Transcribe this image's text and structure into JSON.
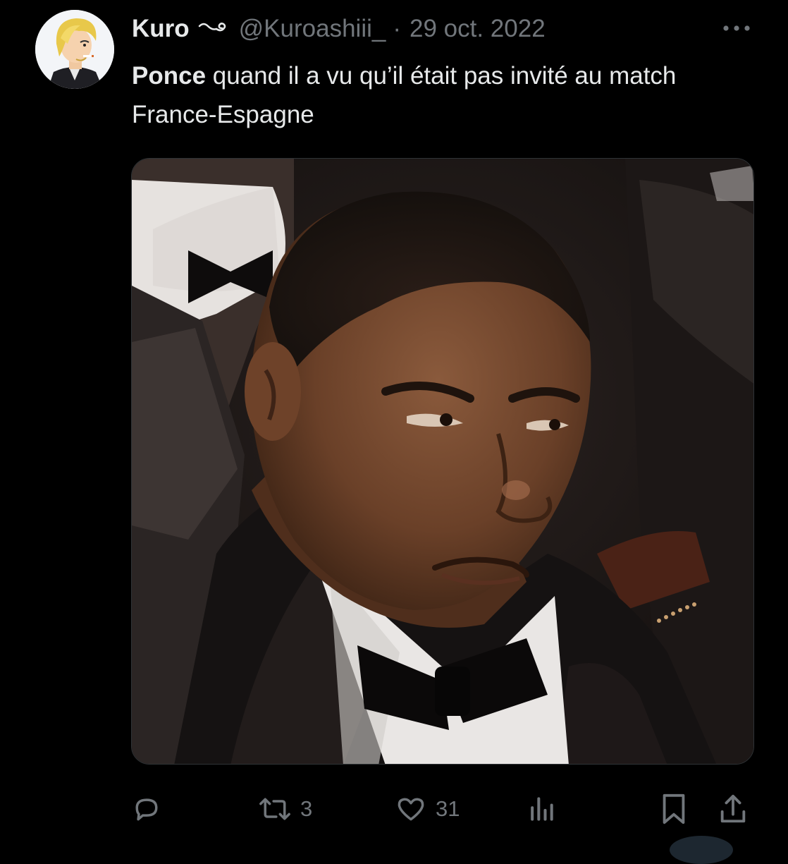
{
  "tweet": {
    "author": {
      "display_name": "Kuro",
      "handle": "@Kuroashiii_",
      "avatar_icon": "anime-avatar"
    },
    "separator": "·",
    "date": "29 oct. 2022",
    "text": {
      "mention": "Ponce",
      "body": " quand il a vu qu’il était pas invité au match France-Espagne"
    },
    "media": {
      "type": "photo"
    },
    "actions": {
      "reply": {
        "icon": "reply-icon",
        "count": ""
      },
      "retweet": {
        "icon": "retweet-icon",
        "count": "3"
      },
      "like": {
        "icon": "heart-icon",
        "count": "31"
      },
      "views": {
        "icon": "analytics-icon",
        "count": ""
      },
      "bookmark": {
        "icon": "bookmark-icon"
      },
      "share": {
        "icon": "share-icon"
      }
    }
  },
  "colors": {
    "background": "#000000",
    "text_primary": "#e7e9ea",
    "text_secondary": "#71767b",
    "border": "#2f3336"
  }
}
